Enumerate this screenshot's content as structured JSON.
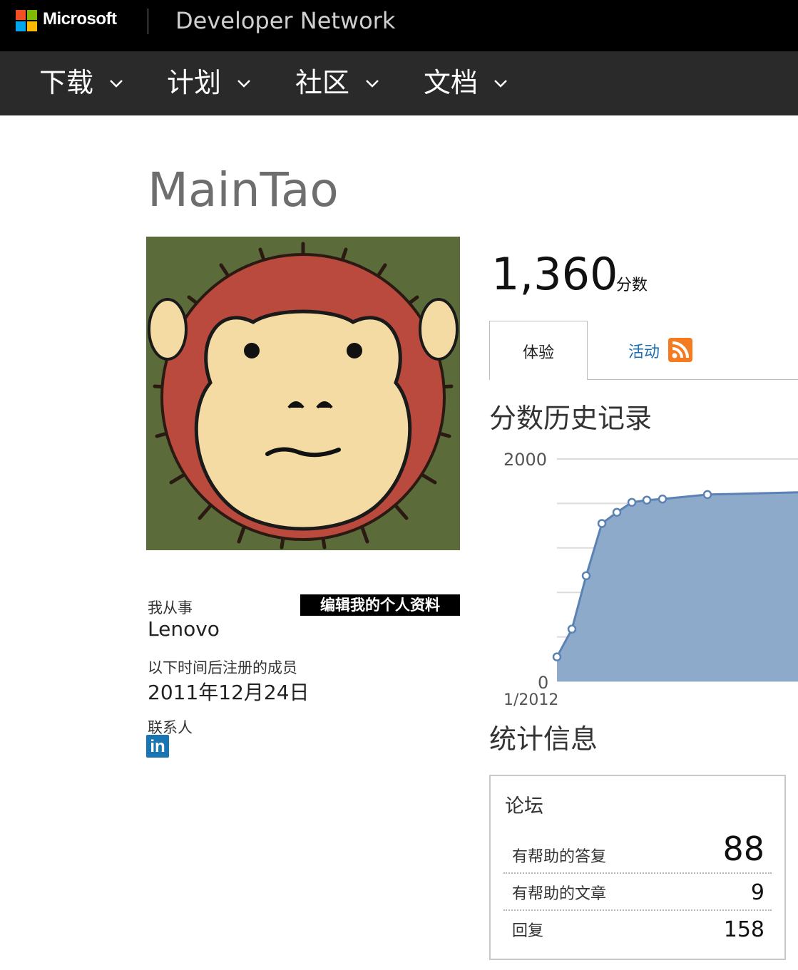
{
  "header": {
    "brand": "Microsoft",
    "site_name": "Developer Network",
    "logo_colors": [
      "#f25022",
      "#7fba00",
      "#00a4ef",
      "#ffb900"
    ]
  },
  "nav": {
    "items": [
      {
        "label": "下载",
        "icon": "chevron-down-icon"
      },
      {
        "label": "计划",
        "icon": "chevron-down-icon"
      },
      {
        "label": "社区",
        "icon": "chevron-down-icon"
      },
      {
        "label": "文档",
        "icon": "chevron-down-icon"
      }
    ]
  },
  "profile": {
    "name": "MainTao",
    "works_at_label": "我从事",
    "works_at": "Lenovo",
    "edit_profile_label": "编辑我的个人资料",
    "member_since_label": "以下时间后注册的成员",
    "member_since": "2011年12月24日",
    "contacts_label": "联系人",
    "linkedin_text": "in"
  },
  "points": {
    "value": "1,360",
    "label": "分数"
  },
  "tabs": {
    "experience": "体验",
    "activity": "活动"
  },
  "history": {
    "title": "分数历史记录"
  },
  "chart_data": {
    "type": "area",
    "y_tick_labels": [
      "2000",
      "0"
    ],
    "x_tick_labels": [
      "1/2012"
    ],
    "ylim": [
      0,
      2000
    ],
    "grid": true,
    "fill_color": "#8eaacb",
    "line_color": "#5b82b4",
    "values": [
      220,
      470,
      950,
      1420,
      1520,
      1610,
      1630,
      1640,
      1680,
      1700
    ]
  },
  "stats": {
    "title": "统计信息",
    "forum_title": "论坛",
    "rows": [
      {
        "label": "有帮助的答复",
        "value": "88"
      },
      {
        "label": "有帮助的文章",
        "value": "9"
      },
      {
        "label": "回复",
        "value": "158"
      }
    ]
  }
}
